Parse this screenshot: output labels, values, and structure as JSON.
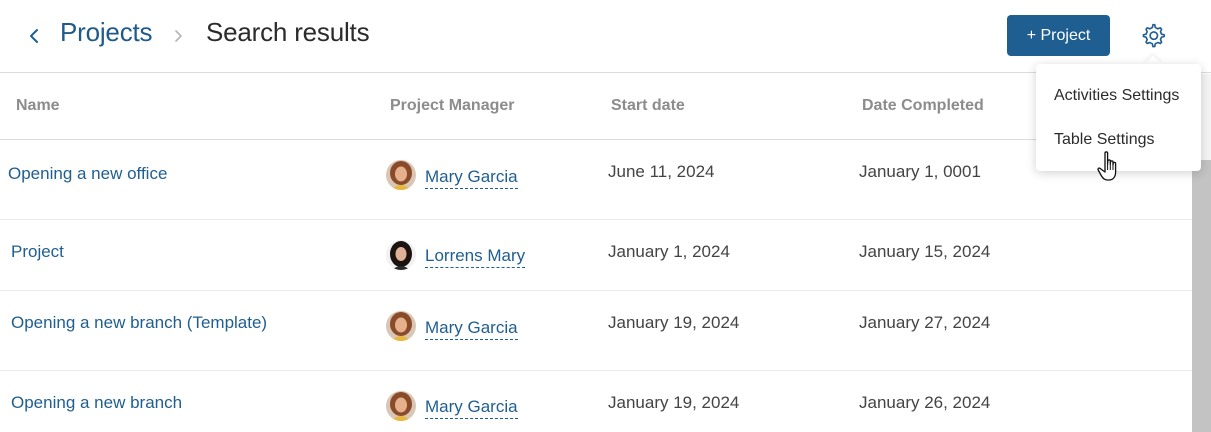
{
  "header": {
    "breadcrumb_root": "Projects",
    "title": "Search results",
    "add_button_label": "+ Project"
  },
  "table": {
    "columns": {
      "name": "Name",
      "manager": "Project Manager",
      "start": "Start date",
      "completed": "Date Completed"
    },
    "rows": [
      {
        "name": "Opening a new office",
        "manager": "Mary Garcia",
        "start": "June 11, 2024",
        "completed": "January 1, 0001"
      },
      {
        "name": "Project",
        "manager": "Lorrens Mary",
        "start": "January 1, 2024",
        "completed": "January 15, 2024"
      },
      {
        "name": "Opening a new branch (Template)",
        "manager": "Mary Garcia",
        "start": "January 19, 2024",
        "completed": "January 27, 2024"
      },
      {
        "name": "Opening a new branch",
        "manager": "Mary Garcia",
        "start": "January 19, 2024",
        "completed": "January 26, 2024"
      }
    ]
  },
  "settings_menu": {
    "items": [
      "Activities Settings",
      "Table Settings"
    ]
  },
  "colors": {
    "accent": "#1f5e91",
    "header_text": "#8c8c8c"
  },
  "icons": [
    "chevron-left-icon",
    "chevron-right-icon",
    "gear-icon",
    "hand-pointer-icon"
  ]
}
